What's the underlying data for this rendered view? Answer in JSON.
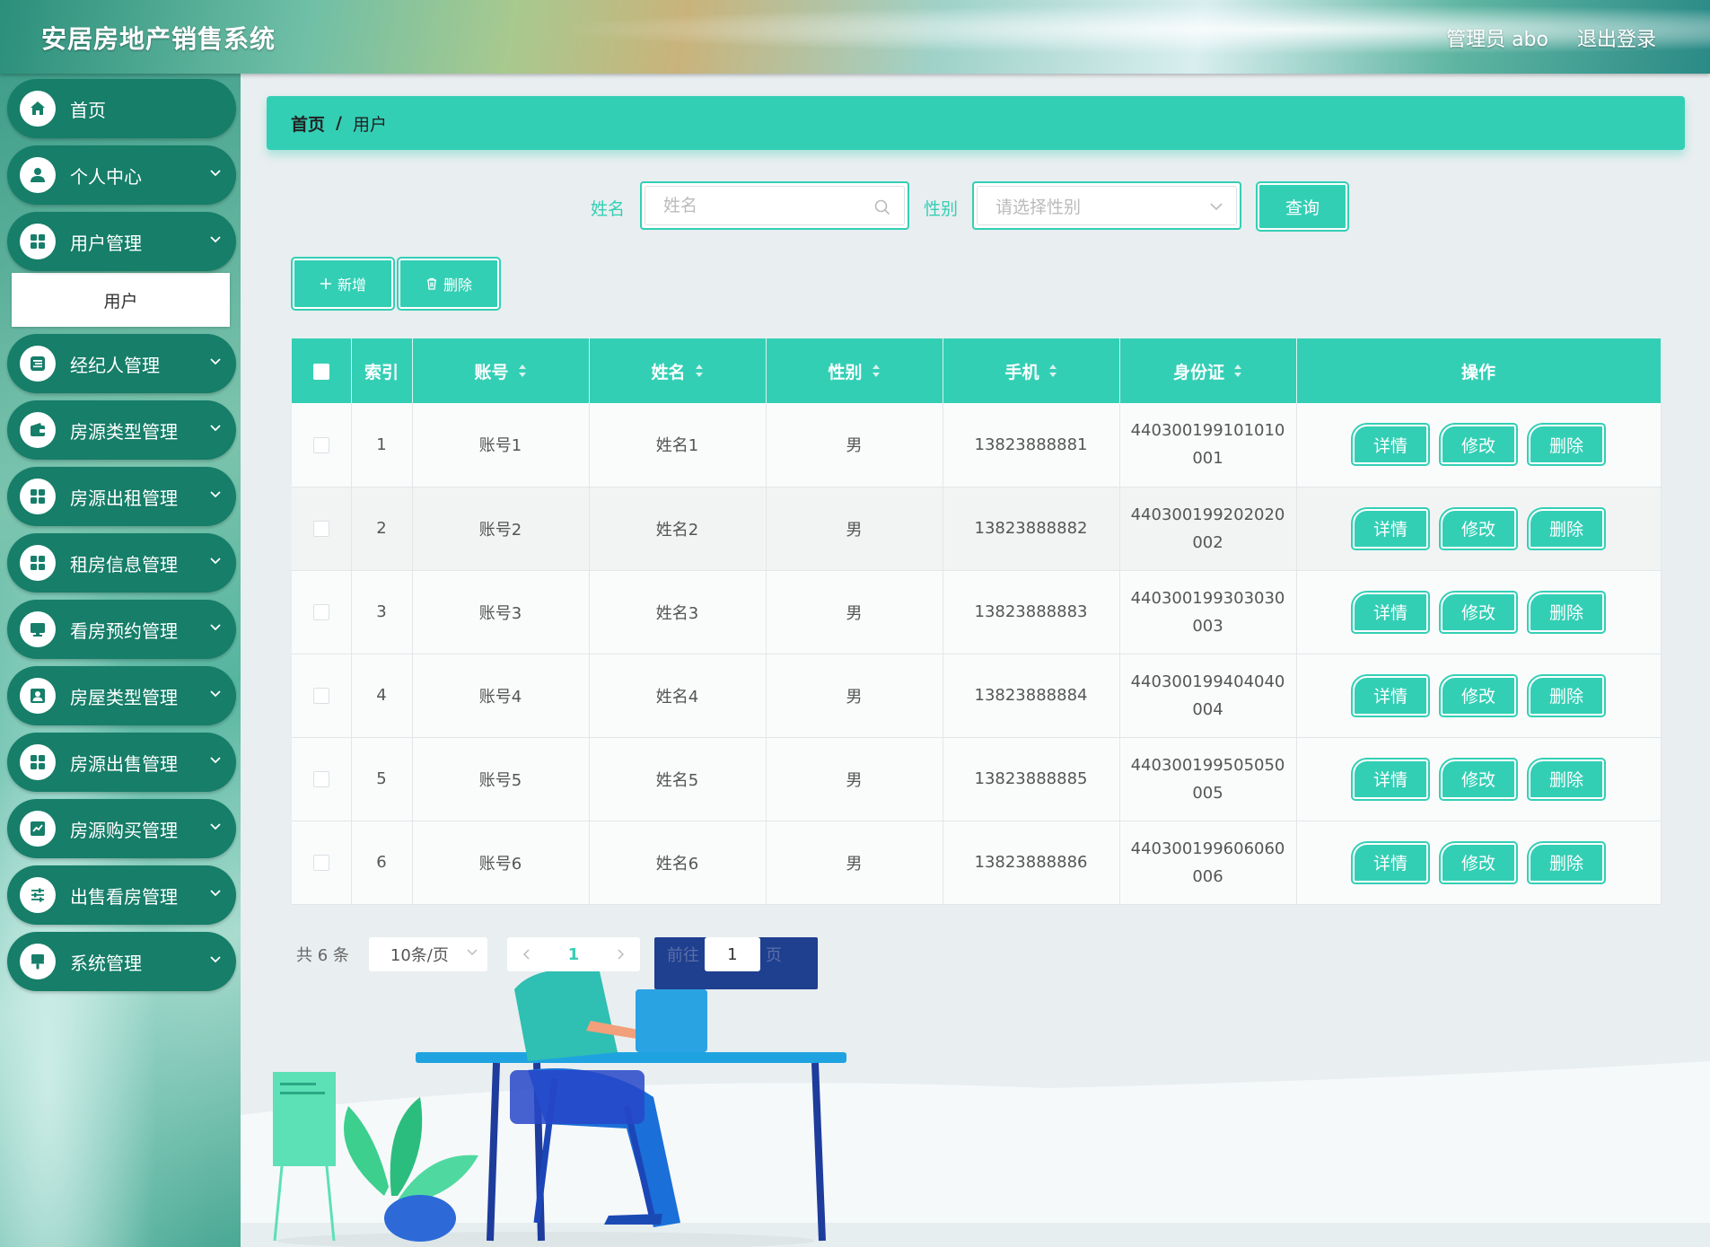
{
  "header": {
    "app_title": "安居房地产销售系统",
    "admin_label": "管理员 abo",
    "logout_label": "退出登录"
  },
  "sidebar": {
    "items": [
      {
        "label": "首页",
        "icon": "home-icon"
      },
      {
        "label": "个人中心",
        "icon": "user-icon"
      },
      {
        "label": "用户管理",
        "icon": "grid-icon",
        "sub": "用户"
      },
      {
        "label": "经纪人管理",
        "icon": "list-icon"
      },
      {
        "label": "房源类型管理",
        "icon": "wallet-icon"
      },
      {
        "label": "房源出租管理",
        "icon": "grid-icon"
      },
      {
        "label": "租房信息管理",
        "icon": "grid-icon"
      },
      {
        "label": "看房预约管理",
        "icon": "monitor-icon"
      },
      {
        "label": "房屋类型管理",
        "icon": "user-icon"
      },
      {
        "label": "房源出售管理",
        "icon": "grid-icon"
      },
      {
        "label": "房源购买管理",
        "icon": "chart-icon"
      },
      {
        "label": "出售看房管理",
        "icon": "sliders-icon"
      },
      {
        "label": "系统管理",
        "icon": "brush-icon"
      }
    ]
  },
  "breadcrumb": {
    "home": "首页",
    "separator": "/",
    "current": "用户"
  },
  "search": {
    "name_label": "姓名",
    "name_placeholder": "姓名",
    "gender_label": "性别",
    "gender_placeholder": "请选择性别",
    "query_label": "查询"
  },
  "actions": {
    "add_label": "新增",
    "delete_label": "删除"
  },
  "table": {
    "columns": [
      "索引",
      "账号",
      "姓名",
      "性别",
      "手机",
      "身份证",
      "操作"
    ],
    "rows": [
      {
        "index": "1",
        "account": "账号1",
        "name": "姓名1",
        "gender": "男",
        "phone": "13823888881",
        "id_line1": "440300199101010",
        "id_line2": "001"
      },
      {
        "index": "2",
        "account": "账号2",
        "name": "姓名2",
        "gender": "男",
        "phone": "13823888882",
        "id_line1": "440300199202020",
        "id_line2": "002"
      },
      {
        "index": "3",
        "account": "账号3",
        "name": "姓名3",
        "gender": "男",
        "phone": "13823888883",
        "id_line1": "440300199303030",
        "id_line2": "003"
      },
      {
        "index": "4",
        "account": "账号4",
        "name": "姓名4",
        "gender": "男",
        "phone": "13823888884",
        "id_line1": "440300199404040",
        "id_line2": "004"
      },
      {
        "index": "5",
        "account": "账号5",
        "name": "姓名5",
        "gender": "男",
        "phone": "13823888885",
        "id_line1": "440300199505050",
        "id_line2": "005"
      },
      {
        "index": "6",
        "account": "账号6",
        "name": "姓名6",
        "gender": "男",
        "phone": "13823888886",
        "id_line1": "440300199606060",
        "id_line2": "006"
      }
    ],
    "op_detail": "详情",
    "op_edit": "修改",
    "op_delete": "删除"
  },
  "pagination": {
    "total": "共 6 条",
    "page_size": "10条/页",
    "current_page": "1",
    "goto_prefix": "前往",
    "goto_value": "1",
    "goto_suffix": "页"
  },
  "colors": {
    "accent": "#33cfb5",
    "sidebar_item": "#167e69"
  }
}
